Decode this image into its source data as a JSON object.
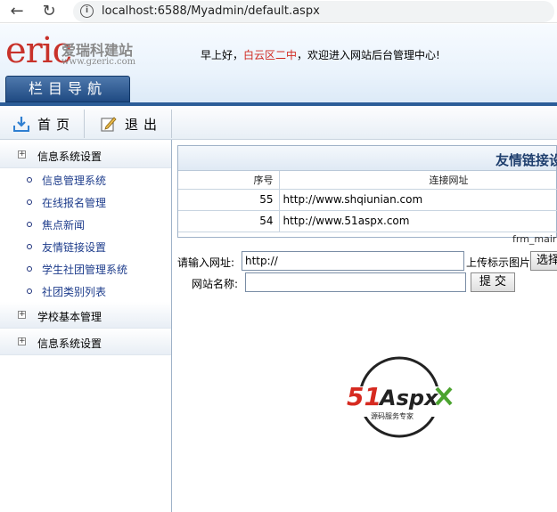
{
  "browser": {
    "url": "localhost:6588/Myadmin/default.aspx"
  },
  "header": {
    "logo_text": "eric",
    "logo_cn": "爱瑞科建站",
    "logo_site": "www.gzeric.com",
    "greeting_prefix": "早上好，",
    "greeting_user": "白云区二中",
    "greeting_suffix": "，欢迎进入网站后台管理中心!",
    "nav_title": "栏目导航"
  },
  "toolbar": {
    "home_label": "首页",
    "exit_label": "退出"
  },
  "sidebar": {
    "sections": [
      {
        "label": "信息系统设置",
        "items": [
          "信息管理系统",
          "在线报名管理",
          "焦点新闻",
          "友情链接设置",
          "学生社团管理系统",
          "社团类别列表"
        ]
      },
      {
        "label": "学校基本管理",
        "items": []
      },
      {
        "label": "信息系统设置",
        "items": []
      }
    ]
  },
  "main": {
    "panel_title": "友情链接设",
    "table": {
      "headers": [
        "序号",
        "连接网址"
      ],
      "rows": [
        [
          "55",
          "http://www.shqiunian.com"
        ],
        [
          "54",
          "http://www.51aspx.com"
        ]
      ]
    },
    "frame_label": "frm_mair",
    "form": {
      "url_label": "请输入网址:",
      "url_value": "http://",
      "upload_label": "上传标示图片",
      "choose_button": "选择",
      "name_label": "网站名称:",
      "name_value": "",
      "submit_button": "提 交"
    }
  },
  "watermark": {
    "brand": "51Aspx",
    "tagline": "源码服务专家"
  },
  "colors": {
    "header_blue": "#2c5d98",
    "greeting_red": "#d0281f",
    "logo_red": "#c8322a",
    "link_blue": "#1e3d8c"
  }
}
